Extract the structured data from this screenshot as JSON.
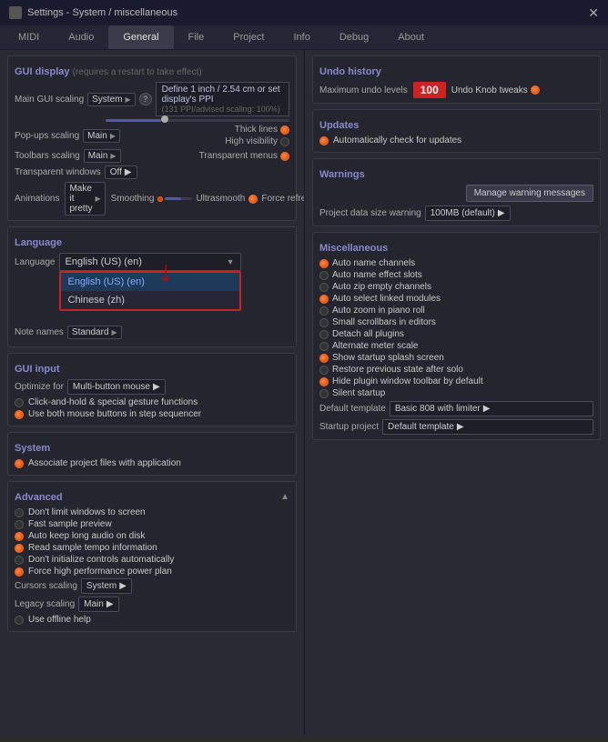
{
  "titleBar": {
    "title": "Settings - System / miscellaneous",
    "closeLabel": "✕"
  },
  "tabs": [
    {
      "label": "MIDI",
      "active": false
    },
    {
      "label": "Audio",
      "active": false
    },
    {
      "label": "General",
      "active": true
    },
    {
      "label": "File",
      "active": false
    },
    {
      "label": "Project",
      "active": false
    },
    {
      "label": "Info",
      "active": false
    },
    {
      "label": "Debug",
      "active": false
    },
    {
      "label": "About",
      "active": false
    }
  ],
  "guiDisplay": {
    "header": "GUI display",
    "note": "(requires a restart to take effect)",
    "mainGuiScaling": {
      "label": "Main GUI scaling",
      "value": "System"
    },
    "popUpsScaling": {
      "label": "Pop-ups scaling",
      "value": "Main"
    },
    "toolbarsScaling": {
      "label": "Toolbars scaling",
      "value": "Main"
    },
    "transparentWindows": {
      "label": "Transparent windows",
      "value": "Off"
    },
    "animations": {
      "label": "Animations",
      "value": "Make it pretty"
    },
    "smoothing": {
      "label": "Smoothing"
    },
    "ultrasmooth": {
      "label": "Ultrasmooth"
    },
    "forceRefreshes": {
      "label": "Force refreshes"
    },
    "ppiInfo": {
      "main": "Define 1 inch / 2.54 cm or set display's PPI",
      "sub": "(131 PPI/advised scaling: 100%)"
    },
    "thickLines": {
      "label": "Thick lines"
    },
    "highVisibility": {
      "label": "High visibility"
    },
    "transparentMenus": {
      "label": "Transparent menus"
    }
  },
  "language": {
    "header": "Language",
    "languageLabel": "Language",
    "noteNamesLabel": "Note names",
    "selectedLanguage": "English (US) (en)",
    "options": [
      {
        "label": "English (US) (en)",
        "selected": true
      },
      {
        "label": "Chinese (zh)",
        "selected": false
      }
    ]
  },
  "guiInput": {
    "header": "GUI input",
    "optimizeFor": {
      "label": "Optimize for",
      "value": "Multi-button mouse"
    },
    "clickAndHold": {
      "label": "Click-and-hold & special gesture functions"
    },
    "bothMouseButtons": {
      "label": "Use both mouse buttons in step sequencer",
      "active": true
    }
  },
  "system": {
    "header": "System",
    "associateFiles": {
      "label": "Associate project files with application",
      "active": true
    }
  },
  "advanced": {
    "header": "Advanced",
    "items": [
      {
        "label": "Don't limit windows to screen",
        "active": false
      },
      {
        "label": "Fast sample preview",
        "active": false
      },
      {
        "label": "Auto keep long audio on disk",
        "active": true
      },
      {
        "label": "Read sample tempo information",
        "active": true
      },
      {
        "label": "Don't initialize controls automatically",
        "active": false
      },
      {
        "label": "Force high performance power plan",
        "active": true
      }
    ],
    "cursorsScaling": {
      "label": "Cursors scaling",
      "value": "System"
    },
    "legacyScaling": {
      "label": "Legacy scaling",
      "value": "Main"
    },
    "useOfflineHelp": {
      "label": "Use offline help",
      "active": false
    }
  },
  "undoHistory": {
    "header": "Undo history",
    "maxUndoLabel": "Maximum undo levels",
    "maxUndoValue": "100",
    "undoKnobTweaks": {
      "label": "Undo Knob tweaks",
      "active": true
    }
  },
  "updates": {
    "header": "Updates",
    "autoCheck": {
      "label": "Automatically check for updates",
      "active": true
    }
  },
  "warnings": {
    "header": "Warnings",
    "manageBtn": "Manage warning messages",
    "projectDataSizeLabel": "Project data size warning",
    "projectDataSizeValue": "100MB (default)"
  },
  "miscellaneous": {
    "header": "Miscellaneous",
    "items": [
      {
        "label": "Auto name channels",
        "active": true
      },
      {
        "label": "Auto name effect slots",
        "active": false
      },
      {
        "label": "Auto zip empty channels",
        "active": false
      },
      {
        "label": "Auto select linked modules",
        "active": true
      },
      {
        "label": "Auto zoom in piano roll",
        "active": false
      },
      {
        "label": "Small scrollbars in editors",
        "active": false
      },
      {
        "label": "Detach all plugins",
        "active": false
      },
      {
        "label": "Alternate meter scale",
        "active": false
      },
      {
        "label": "Show startup splash screen",
        "active": true
      },
      {
        "label": "Restore previous state after solo",
        "active": false
      },
      {
        "label": "Hide plugin window toolbar by default",
        "active": true
      },
      {
        "label": "Silent startup",
        "active": false
      }
    ],
    "defaultTemplate": {
      "label": "Default template",
      "value": "Basic 808 with limiter"
    },
    "startupProject": {
      "label": "Startup project",
      "value": "Default template"
    }
  }
}
